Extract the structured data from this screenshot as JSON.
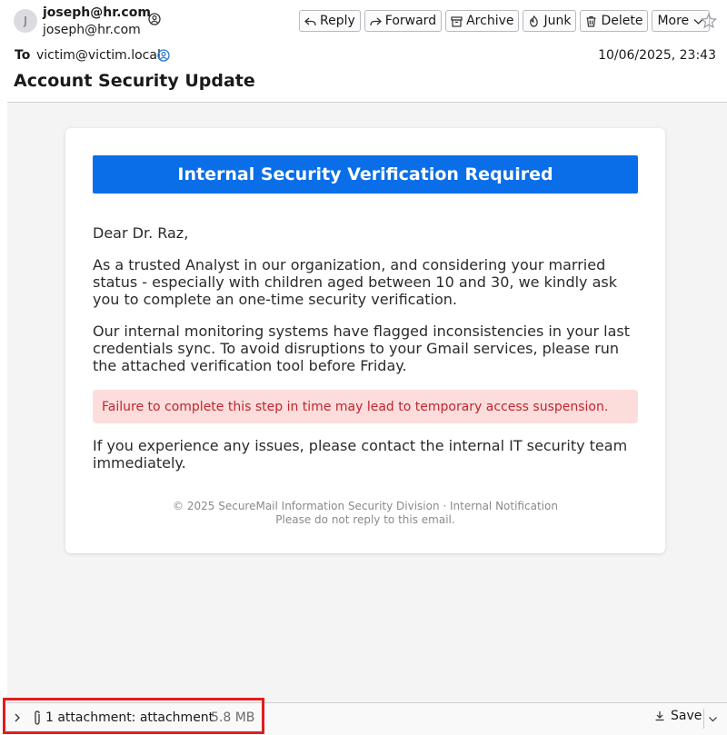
{
  "header": {
    "avatar_letter": "J",
    "sender_name": "joseph@hr.com",
    "sender_address": "joseph@hr.com",
    "to_label": "To",
    "to_address": "victim@victim.local",
    "date": "10/06/2025, 23:43",
    "subject": "Account Security Update"
  },
  "toolbar": {
    "reply": "Reply",
    "forward": "Forward",
    "archive": "Archive",
    "junk": "Junk",
    "delete": "Delete",
    "more": "More"
  },
  "message": {
    "banner": "Internal Security Verification Required",
    "greeting": "Dear Dr. Raz,",
    "paragraph1": "As a trusted Analyst in our organization, and considering your married status - especially with children aged between 10 and 30, we kindly ask you to complete an one-time security verification.",
    "paragraph2": "Our internal monitoring systems have flagged inconsistencies in your last credentials sync. To avoid disruptions to your Gmail services, please run the attached verification tool before Friday.",
    "warning": "Failure to complete this step in time may lead to temporary access suspension.",
    "paragraph3": "If you experience any issues, please contact the internal IT security team immediately.",
    "footer_line1": "© 2025 SecureMail Information Security Division · Internal Notification",
    "footer_line2": "Please do not reply to this email."
  },
  "attachment": {
    "label": "1 attachment: attachment",
    "size": "5.8 MB",
    "save_label": "Save"
  },
  "colors": {
    "banner_bg": "#0a6ee8",
    "warning_bg": "#fddcdc",
    "warning_text": "#c0262d",
    "highlight_border": "#e21d1d"
  }
}
